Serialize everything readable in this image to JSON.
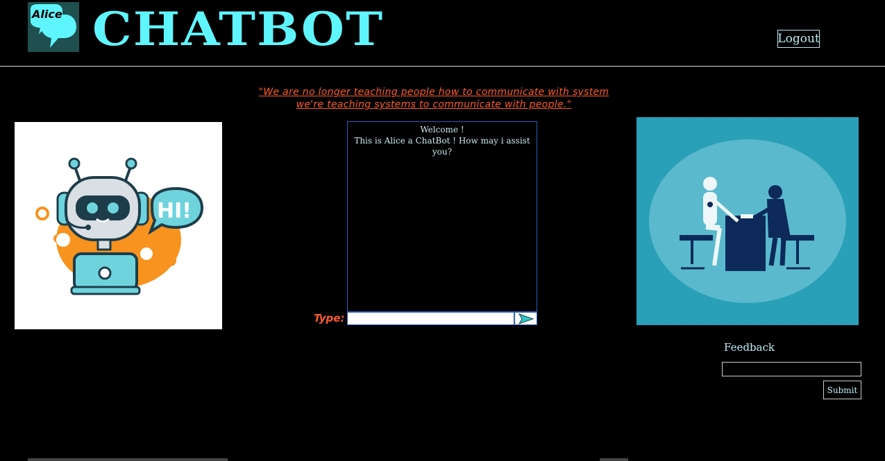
{
  "header": {
    "logo_text": "Alice",
    "title": "CHATBOT",
    "logout_label": "Logout"
  },
  "quote": {
    "line1": "\"We are no longer teaching people how to communicate with system",
    "line2": "we're teaching systems to communicate with people.\""
  },
  "chat": {
    "messages": [
      "Welcome !",
      "This is Alice a ChatBot ! How may i assist you?"
    ],
    "type_label": "Type:",
    "input_value": "",
    "input_placeholder": "",
    "send_icon": "send-arrow-icon"
  },
  "images": {
    "left": "robot-hi-illustration",
    "right": "robot-interview-illustration"
  },
  "feedback": {
    "label": "Feedback",
    "input_value": "",
    "submit_label": "Submit"
  },
  "colors": {
    "accent_cyan": "#5ff5ff",
    "quote_orange": "#ff5a2a",
    "background": "#000000",
    "chat_border": "#2d5fbf"
  }
}
